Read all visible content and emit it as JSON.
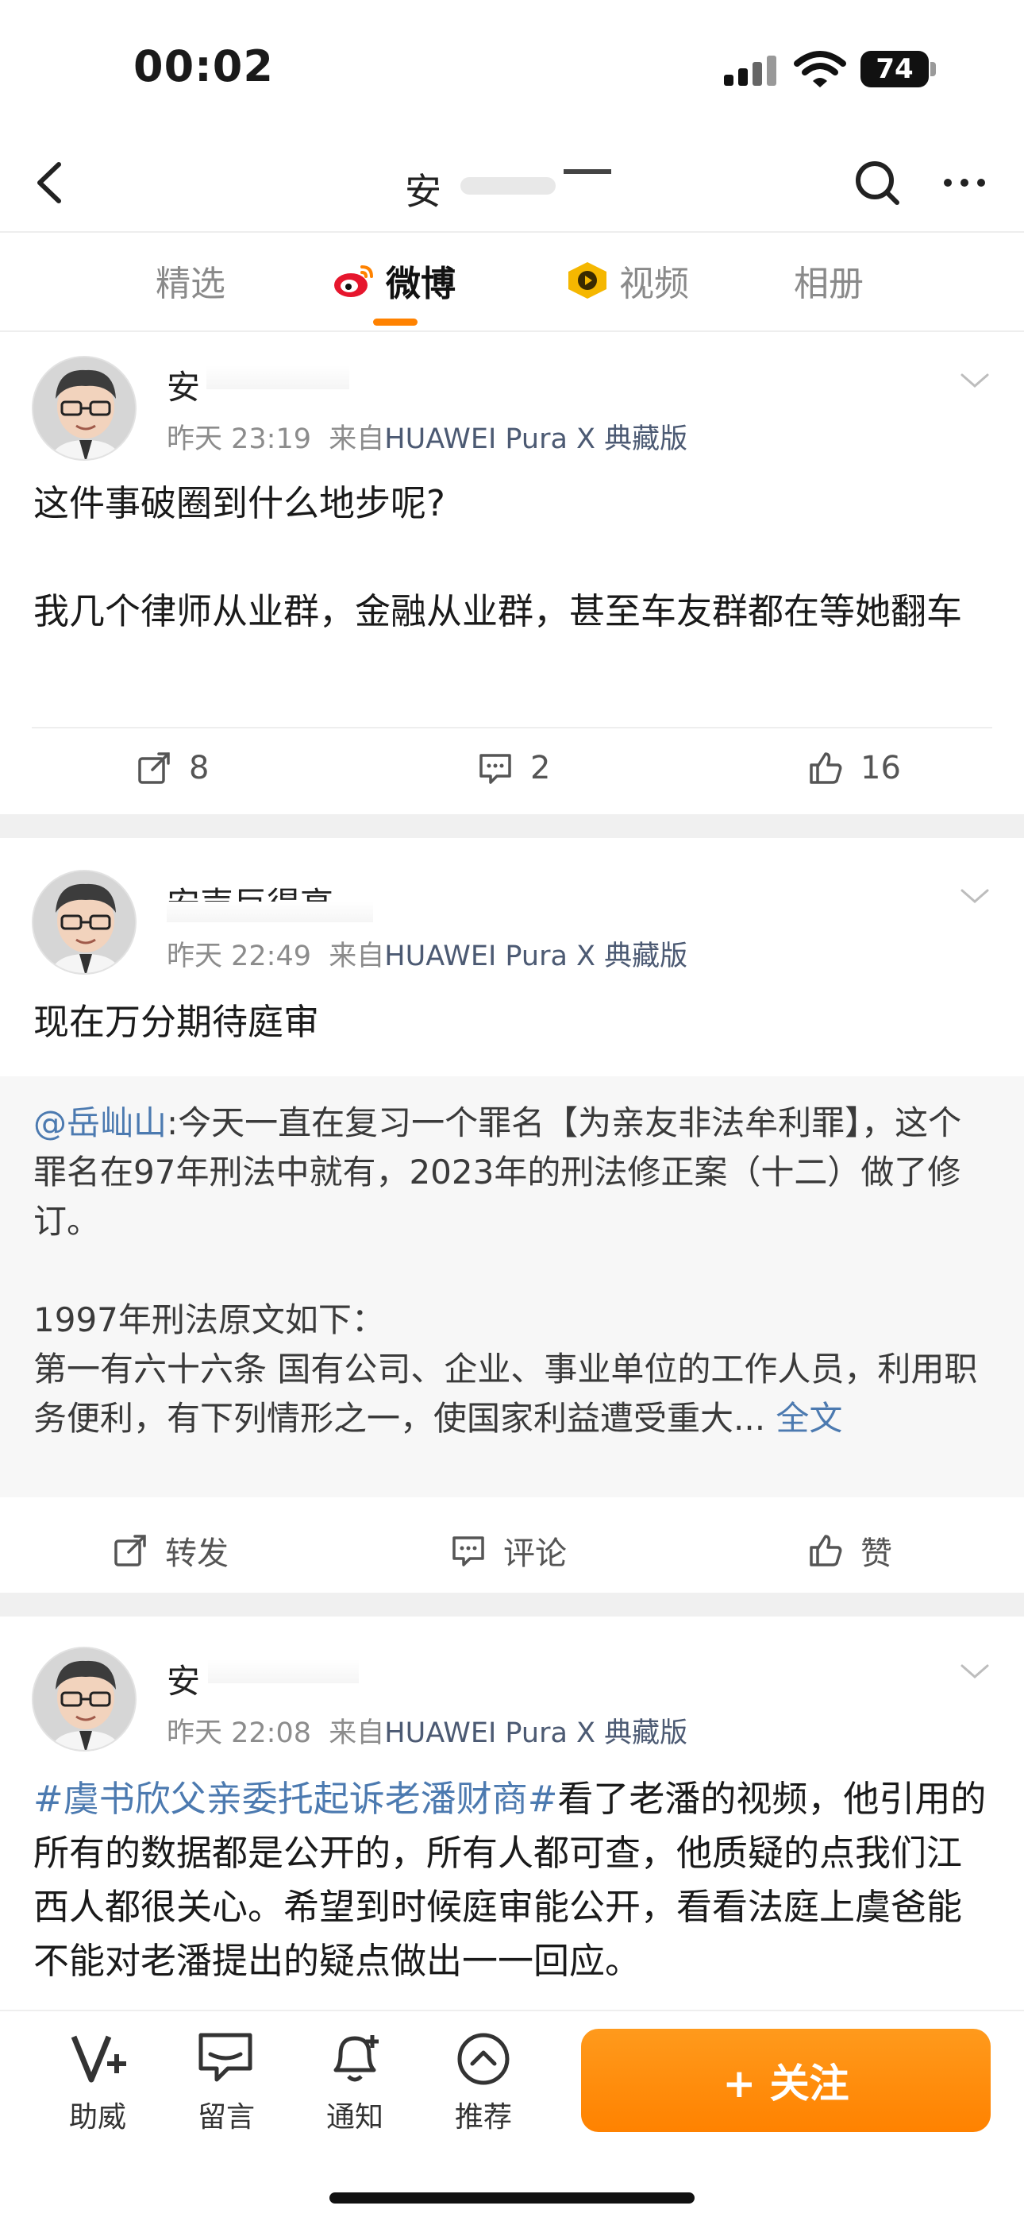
{
  "status_bar": {
    "time": "00:02",
    "battery": "74"
  },
  "header": {
    "title_fragment": "安"
  },
  "tabs": [
    {
      "label": "精选"
    },
    {
      "label": "微博"
    },
    {
      "label": "视频"
    },
    {
      "label": "相册"
    }
  ],
  "posts": [
    {
      "author_fragment": "安",
      "time": "昨天 23:19",
      "source_prefix": "来自",
      "device": "HUAWEI Pura X 典藏版",
      "text": "这件事破圈到什么地步呢?\n\n我几个律师从业群，金融从业群，甚至车友群都在等她翻车",
      "reposts": "8",
      "comments": "2",
      "likes": "16"
    },
    {
      "author_fragment": "安声巨得高",
      "time": "昨天 22:49",
      "source_prefix": "来自",
      "device": "HUAWEI Pura X 典藏版",
      "text": "现在万分期待庭审",
      "quoted": {
        "mention": "@岳屾山",
        "body": ":今天一直在复习一个罪名【为亲友非法牟利罪】，这个罪名在97年刑法中就有，2023年的刑法修正案（十二）做了修订。\n\n1997年刑法原文如下：\n第一有六十六条 国有公司、企业、事业单位的工作人员，利用职务便利，有下列情形之一，使国家利益遭受重大...",
        "full_text_link": "全文"
      },
      "repost_label": "转发",
      "comment_label": "评论",
      "like_label": "赞"
    },
    {
      "author_fragment": "安",
      "time": "昨天 22:08",
      "source_prefix": "来自",
      "device": "HUAWEI Pura X 典藏版",
      "hashtag": "#虞书欣父亲委托起诉老潘财商#",
      "text": "看了老潘的视频，他引用的所有的数据都是公开的，所有人都可查，他质疑的点我们江西人都很关心。希望到时候庭审能公开，看看法庭上虞爸能不能对老潘提出的疑点做出一一回应。"
    }
  ],
  "bottom_bar": {
    "items": [
      {
        "label": "助威"
      },
      {
        "label": "留言"
      },
      {
        "label": "通知"
      },
      {
        "label": "推荐"
      }
    ],
    "follow_label": "+ 关注"
  },
  "colors": {
    "accent": "#ff8200",
    "link": "#4c7ab0",
    "meta_gray": "#8c8c8c"
  }
}
